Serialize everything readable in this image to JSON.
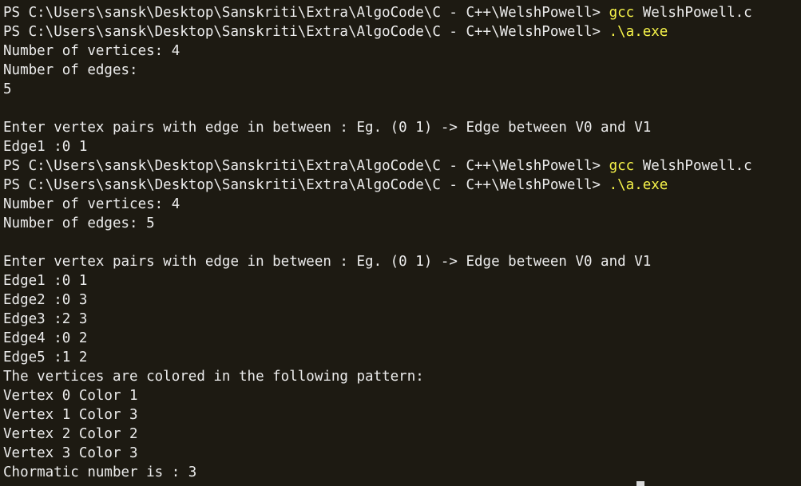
{
  "terminal": {
    "prompt": "PS C:\\Users\\sansk\\Desktop\\Sanskriti\\Extra\\AlgoCode\\C - C++\\WelshPowell> ",
    "compile_cmd": "gcc",
    "compile_arg": " WelshPowell.c",
    "run_cmd": ".\\a.exe",
    "colors": {
      "background": "#1d1a12",
      "text": "#ececec",
      "command": "#f7f44a"
    },
    "run1": {
      "vertices": "Number of vertices: 4",
      "edges_prompt": "Number of edges:",
      "edges_value": "5",
      "blank": "",
      "instructions": "Enter vertex pairs with edge in between : Eg. (0 1) -> Edge between V0 and V1",
      "edge1": "Edge1 :0 1"
    },
    "run2": {
      "vertices": "Number of vertices: 4",
      "edges": "Number of edges: 5",
      "blank": "",
      "instructions": "Enter vertex pairs with edge in between : Eg. (0 1) -> Edge between V0 and V1",
      "edges_list": [
        "Edge1 :0 1",
        "Edge2 :0 3",
        "Edge3 :2 3",
        "Edge4 :0 2",
        "Edge5 :1 2"
      ],
      "pattern_heading": "The vertices are colored in the following pattern:",
      "coloring": [
        "Vertex 0 Color 1",
        "Vertex 1 Color 3",
        "Vertex 2 Color 2",
        "Vertex 3 Color 3"
      ],
      "chromatic": "Chormatic number is : 3"
    }
  }
}
